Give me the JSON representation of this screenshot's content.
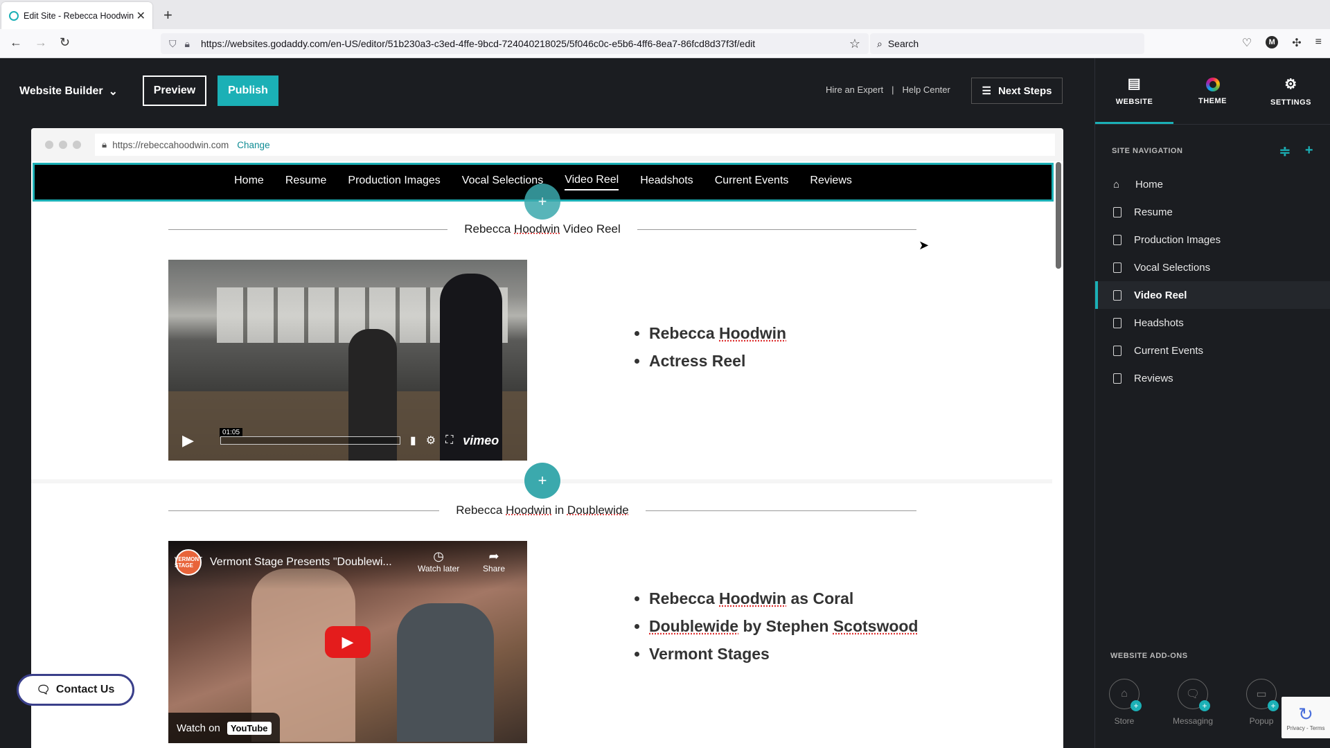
{
  "browser": {
    "tab_title": "Edit Site - Rebecca Hoodwin",
    "url": "https://websites.godaddy.com/en-US/editor/51b230a3-c3ed-4ffe-9bcd-724040218025/5f046c0c-e5b6-4ff6-8ea7-86fcd8d37f3f/edit",
    "search_placeholder": "Search",
    "profile_initial": "M"
  },
  "editor": {
    "builder_label": "Website Builder",
    "preview_label": "Preview",
    "publish_label": "Publish",
    "hire_expert": "Hire an Expert",
    "separator": "|",
    "help_center": "Help Center",
    "next_steps": "Next Steps"
  },
  "site": {
    "domain": "https://rebeccahoodwin.com",
    "change_label": "Change",
    "nav": [
      "Home",
      "Resume",
      "Production Images",
      "Vocal Selections",
      "Video Reel",
      "Headshots",
      "Current Events",
      "Reviews"
    ],
    "active_nav": "Video Reel",
    "section1": {
      "title_prefix": "Rebecca ",
      "title_underlined": "Hoodwin",
      "title_suffix": " Video Reel",
      "video_time": "01:05",
      "video_brand": "vimeo",
      "bullet1_prefix": "Rebecca ",
      "bullet1_underlined": "Hoodwin",
      "bullet2": "Actress Reel"
    },
    "section2": {
      "title_prefix": "Rebecca ",
      "title_u1": "Hoodwin",
      "title_mid": " in ",
      "title_u2": "Doublewide",
      "video_title": "Vermont Stage Presents \"Doublewi...",
      "channel_badge": "VERMONT STAGE",
      "watch_later": "Watch later",
      "share": "Share",
      "watch_on": "Watch on",
      "yt_brand": "YouTube",
      "b1_prefix": "Rebecca ",
      "b1_u": "Hoodwin",
      "b1_suffix": " as Coral",
      "b2_u1": "Doublewide",
      "b2_mid": " by Stephen ",
      "b2_u2": "Scotswood",
      "b3": "Vermont Stages"
    },
    "contact_label": "Contact Us"
  },
  "panel": {
    "tabs": [
      {
        "label": "WEBSITE",
        "icon": "browser-window-icon"
      },
      {
        "label": "THEME",
        "icon": "color-ring-icon"
      },
      {
        "label": "SETTINGS",
        "icon": "gear-icon"
      }
    ],
    "site_navigation_title": "SITE NAVIGATION",
    "pages": [
      "Home",
      "Resume",
      "Production Images",
      "Vocal Selections",
      "Video Reel",
      "Headshots",
      "Current Events",
      "Reviews"
    ],
    "active_page": "Video Reel",
    "addons_title": "WEBSITE ADD-ONS",
    "addons": [
      "Store",
      "Messaging",
      "Popup"
    ],
    "recaptcha_text": "Privacy - Terms"
  },
  "colors": {
    "accent": "#1bb0b6",
    "editor_bg": "#1b1d21"
  }
}
